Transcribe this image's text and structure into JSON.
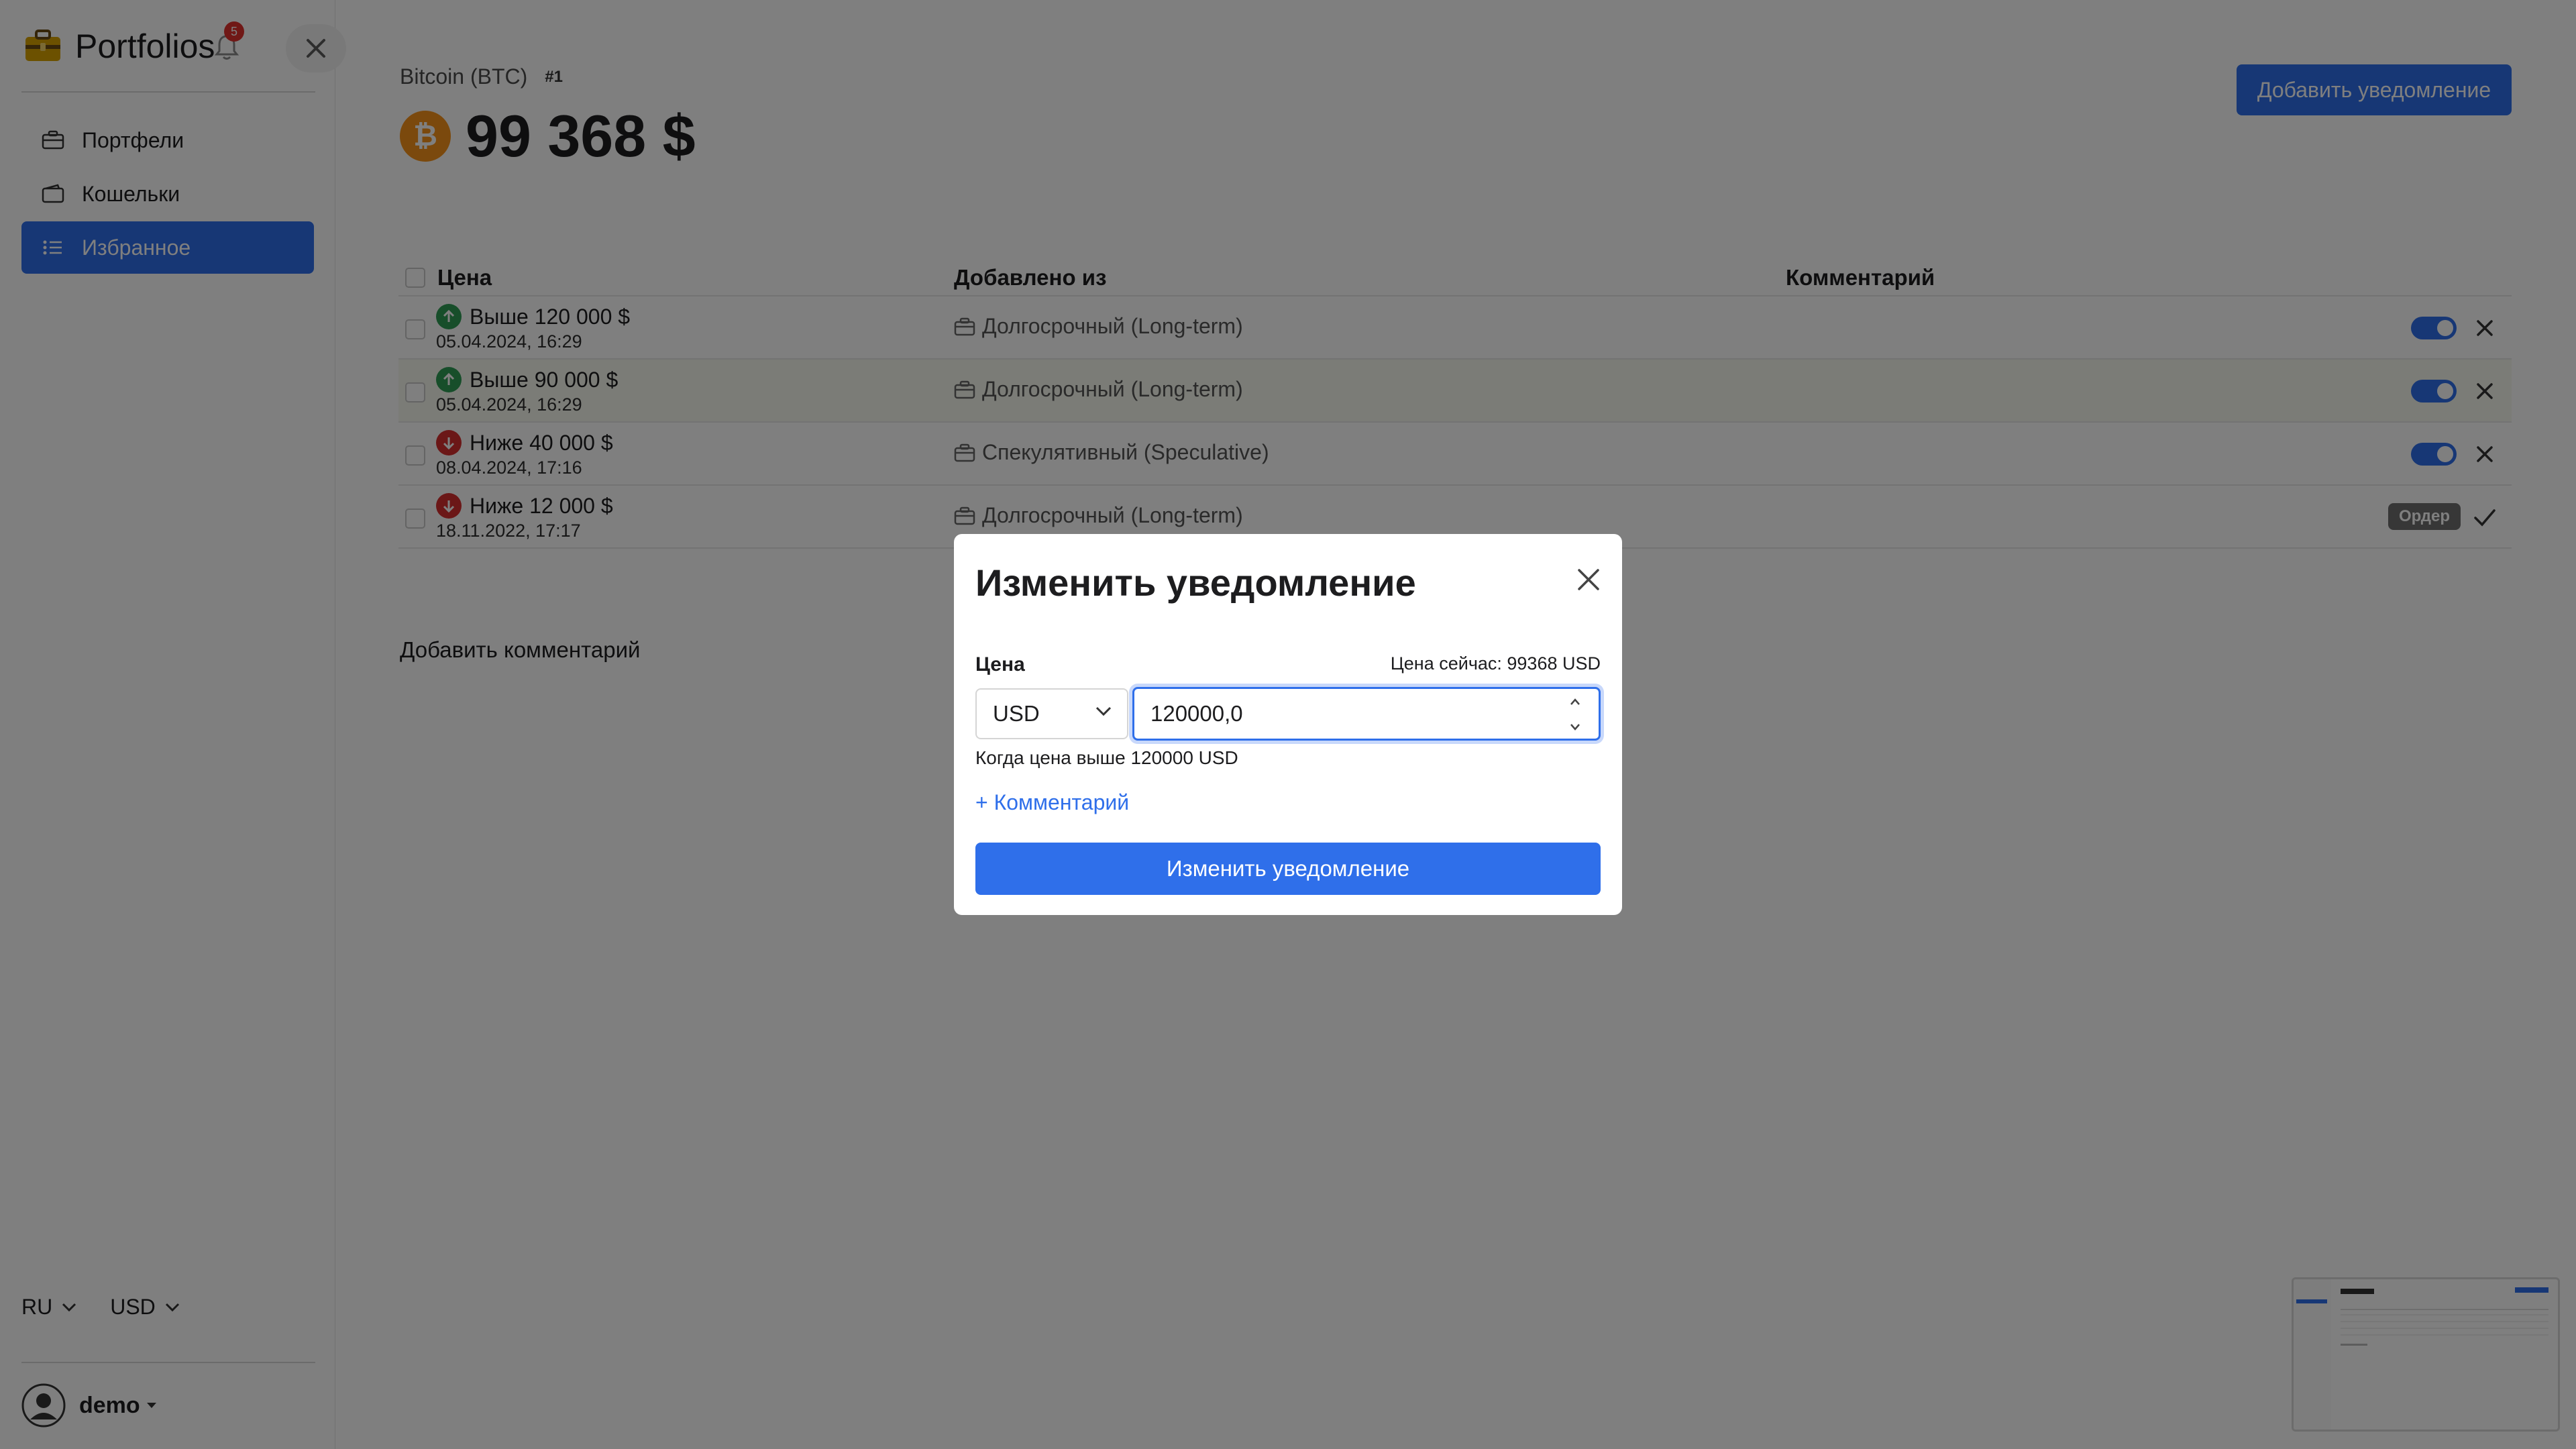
{
  "app": {
    "brand": "Portfolios",
    "notification_count": "5"
  },
  "sidebar": {
    "items": [
      {
        "label": "Портфели",
        "icon": "briefcase-icon"
      },
      {
        "label": "Кошельки",
        "icon": "wallet-icon"
      },
      {
        "label": "Избранное",
        "icon": "list-icon",
        "active": true
      }
    ],
    "language": "RU",
    "currency": "USD",
    "user": "demo"
  },
  "coin": {
    "name": "Bitcoin (BTC)",
    "rank": "#1",
    "price": "99 368 $",
    "icon": "bitcoin-icon"
  },
  "header": {
    "add_alert_label": "Добавить уведомление"
  },
  "table": {
    "columns": [
      "Цена",
      "Добавлено из",
      "Комментарий"
    ],
    "rows": [
      {
        "direction": "up",
        "condition": "Выше 120 000 $",
        "date": "05.04.2024, 16:29",
        "from": "Долгосрочный (Long-term)",
        "enabled": true
      },
      {
        "direction": "up",
        "condition": "Выше 90 000 $",
        "date": "05.04.2024, 16:29",
        "from": "Долгосрочный (Long-term)",
        "enabled": true
      },
      {
        "direction": "down",
        "condition": "Ниже 40 000 $",
        "date": "08.04.2024, 17:16",
        "from": "Спекулятивный (Speculative)",
        "enabled": true
      },
      {
        "direction": "down",
        "condition": "Ниже 12 000 $",
        "date": "18.11.2022, 17:17",
        "from": "Долгосрочный (Long-term)",
        "badge": "Ордер",
        "triggered": true
      }
    ]
  },
  "comment": {
    "add_label": "Добавить комментарий"
  },
  "modal": {
    "title": "Изменить уведомление",
    "price_label": "Цена",
    "current_price": "Цена сейчас: 99368 USD",
    "currency": "USD",
    "value": "120000,0",
    "hint": "Когда цена выше 120000 USD",
    "add_comment": "+ Комментарий",
    "submit": "Изменить уведомление"
  },
  "colors": {
    "accent": "#2f6fea",
    "up": "#2e9c55",
    "down": "#d62f2f",
    "bitcoin": "#f7931a"
  }
}
